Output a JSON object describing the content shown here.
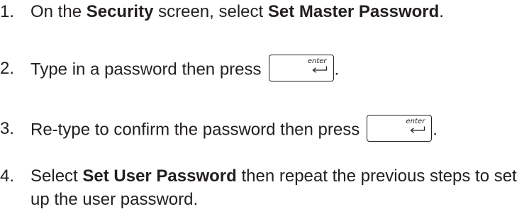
{
  "steps": [
    {
      "number": "1.",
      "text_1": "On the ",
      "bold_1": "Security",
      "text_2": " screen, select ",
      "bold_2": "Set Master Password",
      "text_3": "."
    },
    {
      "number": "2.",
      "text_1": "Type in a password then press",
      "key_label": "enter",
      "text_2": "."
    },
    {
      "number": "3.",
      "text_1": "Re-type to confirm the password then press",
      "key_label": "enter",
      "text_2": "."
    },
    {
      "number": "4.",
      "text_1": "Select ",
      "bold_1": "Set User Password",
      "text_2": " then repeat the previous steps to set up the user password."
    }
  ],
  "icons": {
    "enter_arrow": "enter-arrow-icon"
  }
}
